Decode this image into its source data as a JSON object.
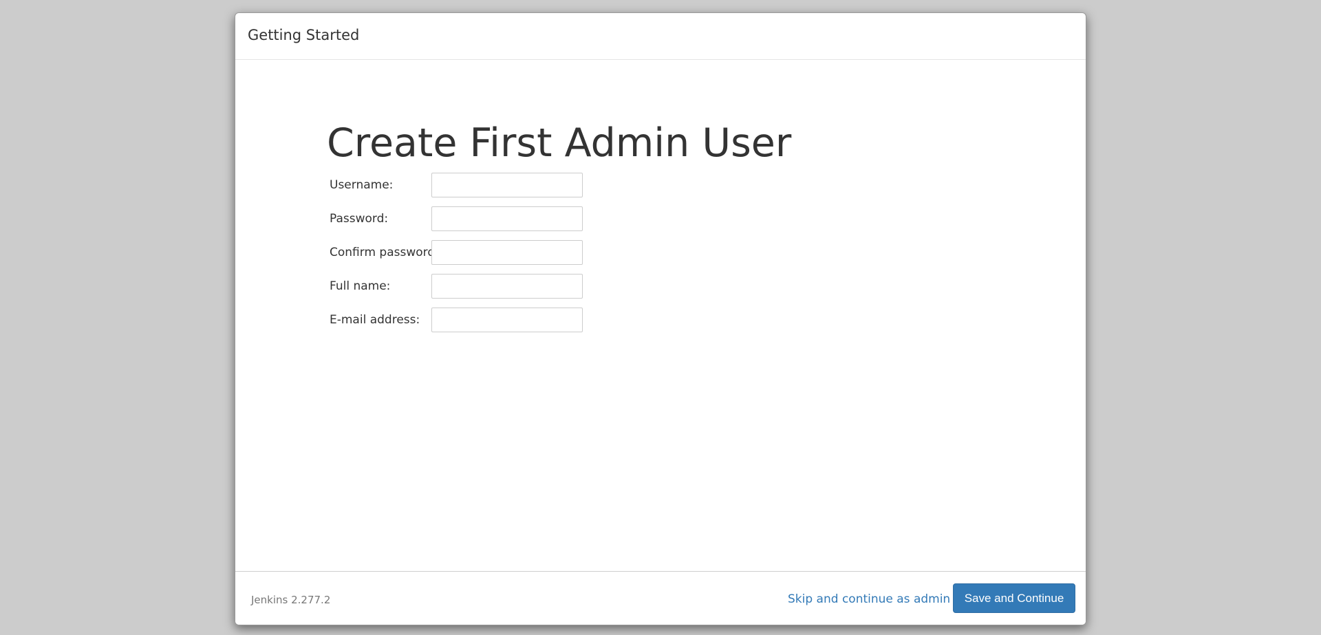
{
  "dialog": {
    "title": "Getting Started"
  },
  "form": {
    "heading": "Create First Admin User",
    "fields": [
      {
        "label": "Username:",
        "value": "",
        "placeholder": ""
      },
      {
        "label": "Password:",
        "value": "",
        "placeholder": ""
      },
      {
        "label": "Confirm password:",
        "value": "",
        "placeholder": ""
      },
      {
        "label": "Full name:",
        "value": "",
        "placeholder": ""
      },
      {
        "label": "E-mail address:",
        "value": "",
        "placeholder": ""
      }
    ]
  },
  "footer": {
    "version": "Jenkins 2.277.2",
    "skip_label": "Skip and continue as admin",
    "save_label": "Save and Continue"
  },
  "colors": {
    "backdrop": "#cccccc",
    "primary": "#337ab7",
    "text": "#333333",
    "muted": "#777777"
  }
}
